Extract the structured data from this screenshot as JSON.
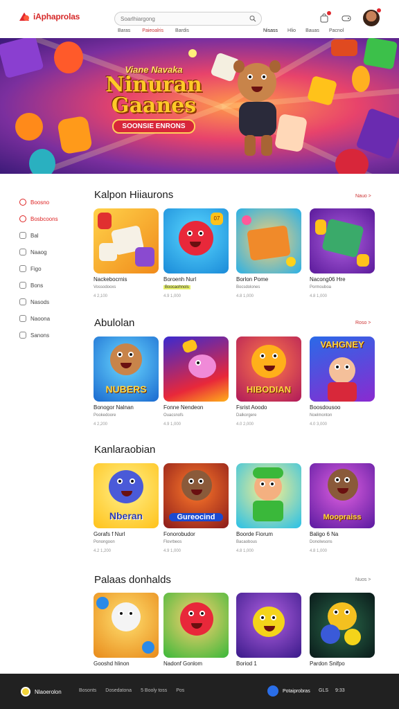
{
  "header": {
    "logo_text": "iAphaprolas",
    "search_placeholder": "Soarlhiargong",
    "nav": [
      "Baras",
      "Paieoalris",
      "Bardis"
    ],
    "nav_right": [
      "Nisass",
      "Hlio",
      "Bauas",
      "Pacnol"
    ],
    "notification_count": "1"
  },
  "banner": {
    "subtitle": "Viane Navaka",
    "title_line1": "Ninuran",
    "title_line2": "Gaanes",
    "pill": "SOONSIE ENRONS"
  },
  "sidebar": {
    "items": [
      {
        "label": "Boosno"
      },
      {
        "label": "Bosbcoons"
      },
      {
        "label": "Bal"
      },
      {
        "label": "Naaog"
      },
      {
        "label": "Figo"
      },
      {
        "label": "Bons"
      },
      {
        "label": "Nasods"
      },
      {
        "label": "Naoona"
      },
      {
        "label": "Sanons"
      }
    ]
  },
  "sections": [
    {
      "title": "Kalpon Hiiaurons",
      "see_all": "Nauo >",
      "cards": [
        {
          "name": "Nackebocrnis",
          "sub": "Vossodooxs",
          "meta": "4 2,100"
        },
        {
          "name": "Boroenh Nurl",
          "sub": "Boocaohnols",
          "meta": "4.9 1,000"
        },
        {
          "name": "Borlon Pome",
          "sub": "Bocsdolones",
          "meta": "4.8 1,000"
        },
        {
          "name": "Nacong06 Hre",
          "sub": "Pormouboa",
          "meta": "4.8 1,000"
        }
      ]
    },
    {
      "title": "Abulolan",
      "see_all": "Roso >",
      "cards": [
        {
          "name": "Bonogor Nalnan",
          "sub": "Pookedoore",
          "meta": "4 2,200"
        },
        {
          "name": "Fonne Nendeon",
          "sub": "Ouacsnofs",
          "meta": "4.9 1,000"
        },
        {
          "name": "Fsrist Aoodo",
          "sub": "Dalkorgere",
          "meta": "4.0 2,000"
        },
        {
          "name": "Boosdousoo",
          "sub": "Noelmonton",
          "meta": "4.0 3,000"
        }
      ]
    },
    {
      "title": "Kanlaraobian",
      "see_all": "",
      "cards": [
        {
          "name": "Gorafs f Nurl",
          "sub": "Ponongoon",
          "meta": "4.2 1,200"
        },
        {
          "name": "Fonorobudor",
          "sub": "Flovrbeos",
          "meta": "4.9 1,000"
        },
        {
          "name": "Boorde Fiorum",
          "sub": "Bacaobous",
          "meta": "4.8 1,000"
        },
        {
          "name": "Baligo 6 Na",
          "sub": "Donolwsons",
          "meta": "4.8 1,000"
        }
      ]
    },
    {
      "title": "Palaas donhalds",
      "see_all": "Nuos >",
      "cards": [
        {
          "name": "Gooshd hlinon",
          "sub": "",
          "meta": ""
        },
        {
          "name": "Nadonf Gonlom",
          "sub": "",
          "meta": ""
        },
        {
          "name": "Boriod 1",
          "sub": "",
          "meta": ""
        },
        {
          "name": "Pardon Snifpo",
          "sub": "",
          "meta": ""
        }
      ]
    }
  ],
  "card_texts": {
    "hero_nubers": "NUBERS",
    "hibodan": "HIBODIAN",
    "nberan": "Nberan",
    "gurooonrd": "Gureocind",
    "moopras": "Moopraiss",
    "aighey": "VAHGNEY",
    "t07": "07"
  },
  "footer": {
    "logo_text": "Nlaoerolon",
    "links": [
      "Bosonts",
      "Dosedatona",
      "5 Booly toss",
      "Pos"
    ],
    "app_label": "Potaiprobras",
    "right": [
      "GLS",
      "9:33"
    ]
  },
  "colors": {
    "accent": "#d22a2a",
    "footer": "#212121"
  }
}
